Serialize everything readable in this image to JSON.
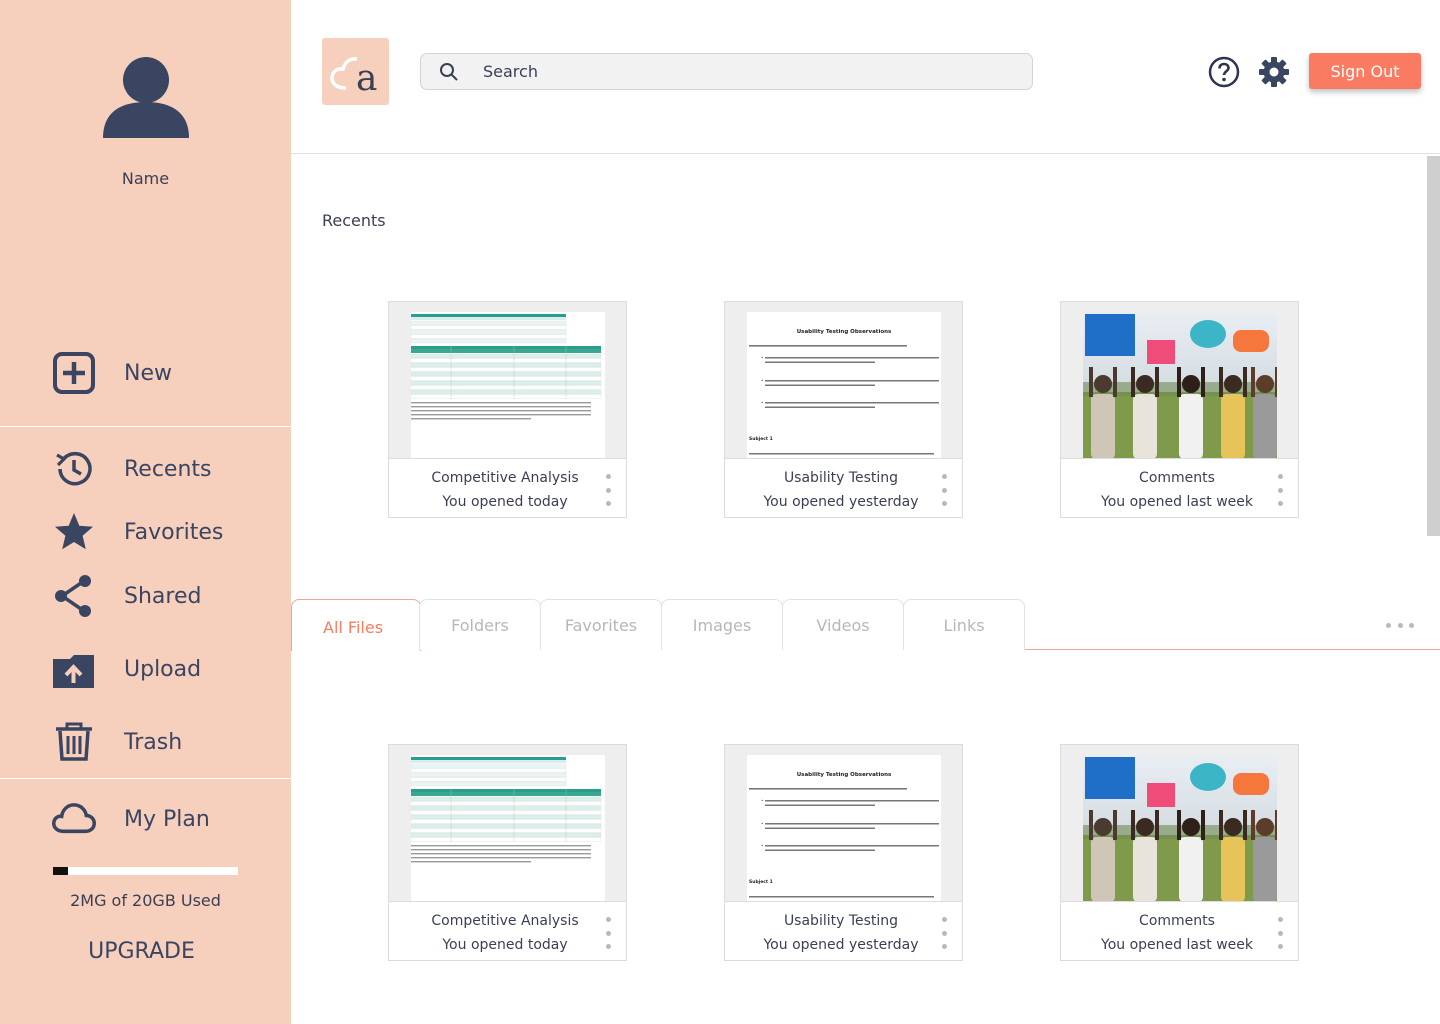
{
  "user": {
    "name": "Name"
  },
  "sidebar": {
    "items": [
      {
        "label": "New",
        "icon": "plus-square-icon"
      },
      {
        "label": "Recents",
        "icon": "history-icon"
      },
      {
        "label": "Favorites",
        "icon": "star-icon"
      },
      {
        "label": "Shared",
        "icon": "share-icon"
      },
      {
        "label": "Upload",
        "icon": "upload-folder-icon"
      },
      {
        "label": "Trash",
        "icon": "trash-icon"
      },
      {
        "label": "My Plan",
        "icon": "cloud-icon"
      }
    ],
    "storage": {
      "text": "2MG of 20GB Used",
      "used_fraction": 0.08
    },
    "upgrade_label": "UPGRADE"
  },
  "header": {
    "logo_letter": "a",
    "search": {
      "placeholder": "Search"
    },
    "signout_label": "Sign Out"
  },
  "recents": {
    "title": "Recents",
    "cards": [
      {
        "title": "Competitive Analysis",
        "subtitle": "You opened today",
        "thumb": "spreadsheet"
      },
      {
        "title": "Usability Testing",
        "subtitle": "You opened yesterday",
        "thumb": "document"
      },
      {
        "title": "Comments",
        "subtitle": "You opened last week",
        "thumb": "photo"
      }
    ]
  },
  "tabs": {
    "items": [
      "All Files",
      "Folders",
      "Favorites",
      "Images",
      "Videos",
      "Links"
    ],
    "active": "All Files"
  },
  "files": {
    "cards": [
      {
        "title": "Competitive Analysis",
        "subtitle": "You opened today",
        "thumb": "spreadsheet"
      },
      {
        "title": "Usability Testing",
        "subtitle": "You opened yesterday",
        "thumb": "document"
      },
      {
        "title": "Comments",
        "subtitle": "You opened last week",
        "thumb": "photo"
      }
    ]
  },
  "thumbnails": {
    "doc_heading": "Usability Testing Observations",
    "doc_subject": "Subject 1"
  },
  "colors": {
    "sidebar_bg": "#f7cfbd",
    "accent": "#f97b62",
    "icon": "#3a4561",
    "table_header": "#2a9d8f"
  }
}
